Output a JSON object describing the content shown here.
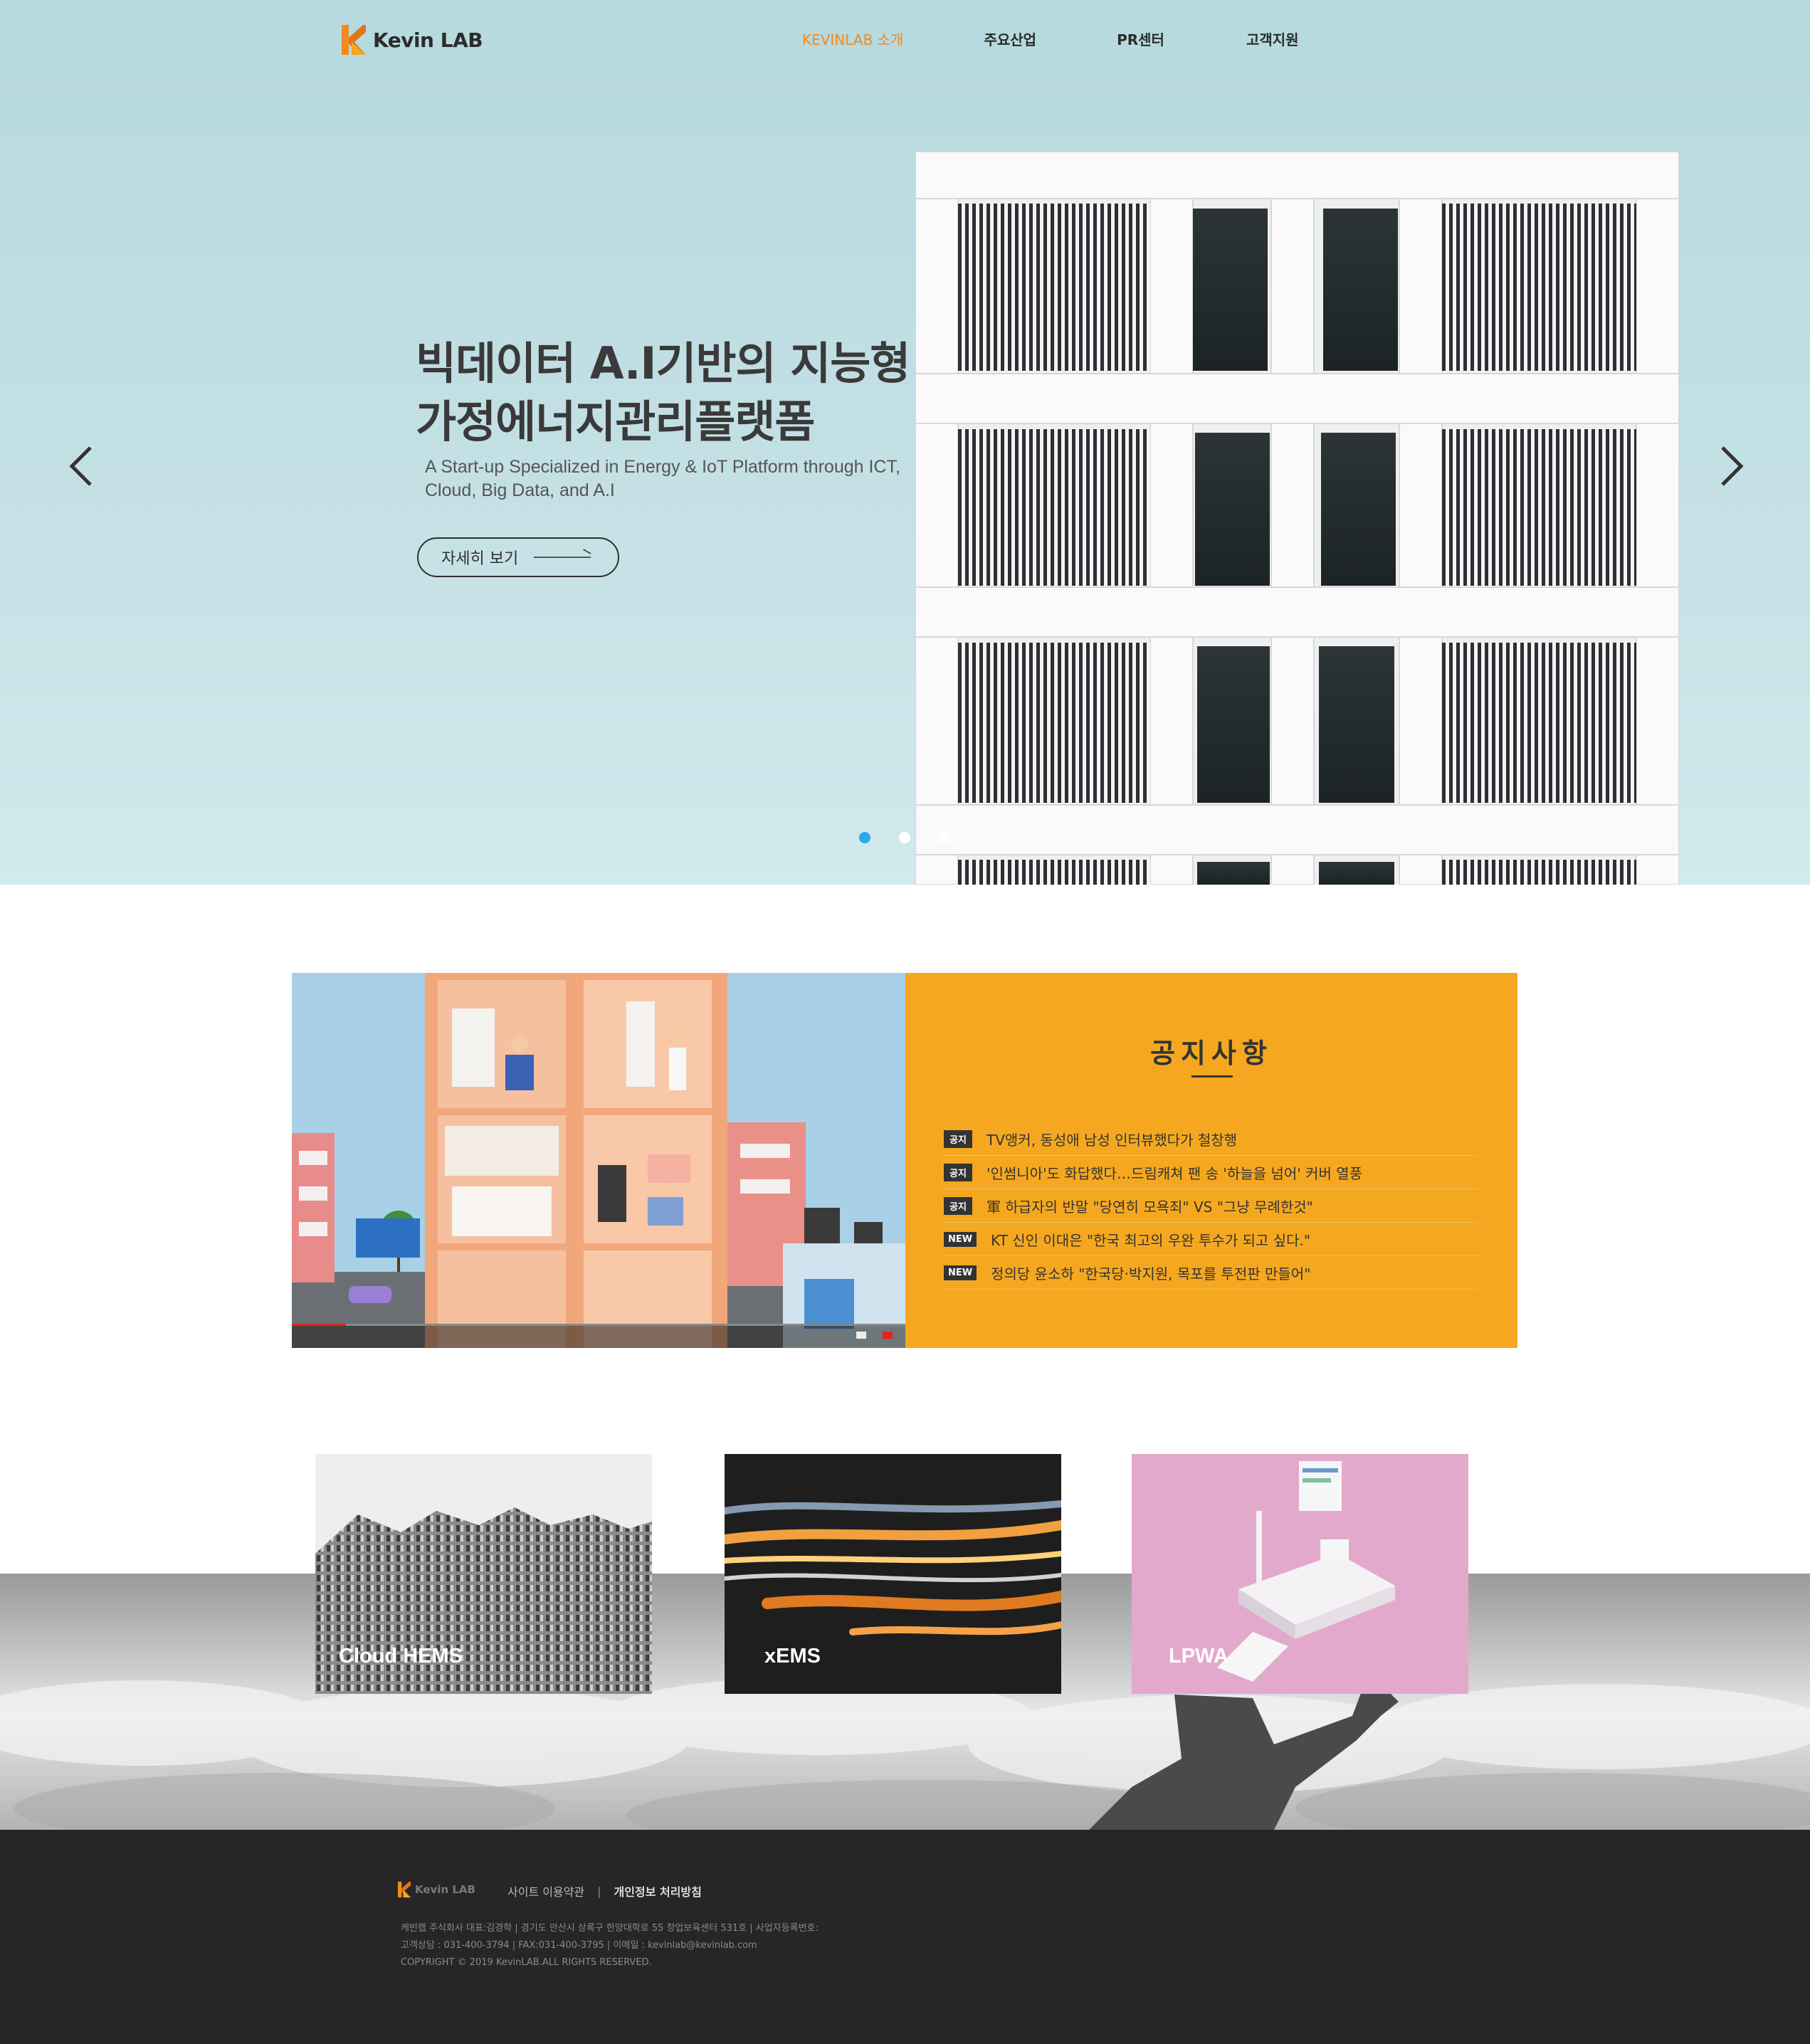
{
  "header": {
    "logo_text": "Kevin LAB",
    "nav": [
      {
        "label": "KEVINLAB 소개",
        "active": true
      },
      {
        "label": "주요산업",
        "active": false
      },
      {
        "label": "PR센터",
        "active": false
      },
      {
        "label": "고객지원",
        "active": false
      }
    ]
  },
  "hero": {
    "title_line1": "빅데이터 A.I기반의 지능형",
    "title_line2": "가정에너지관리플랫폼",
    "subtitle_line1": "A Start-up Specialized in Energy & IoT Platform through ICT,",
    "subtitle_line2": "Cloud, Big Data, and A.I",
    "button_label": "자세히 보기",
    "prev_icon": "chevron-left-icon",
    "next_icon": "chevron-right-icon",
    "slides_total": 3,
    "slide_active": 1
  },
  "notice": {
    "title": "공지사항",
    "items": [
      {
        "badge": "공지",
        "text": "TV앵커, 동성애 남성 인터뷰했다가 철창행"
      },
      {
        "badge": "공지",
        "text": "'인썸니아'도 화답했다…드림캐쳐 팬 송 '하늘을 넘어' 커버 열풍"
      },
      {
        "badge": "공지",
        "text": "軍 하급자의 반말 \"당연히 모욕죄\" VS \"그냥 무례한것\""
      },
      {
        "badge": "NEW",
        "text": "KT 신인 이대은 \"한국 최고의 우완 투수가 되고 싶다.\""
      },
      {
        "badge": "NEW",
        "text": "정의당 윤소하 \"한국당·박지원, 목포를 투전판 만들어\""
      }
    ]
  },
  "services": [
    {
      "label": "Cloud HEMS"
    },
    {
      "label": "xEMS"
    },
    {
      "label": "LPWA"
    }
  ],
  "footer": {
    "logo_text": "Kevin LAB",
    "links": [
      "사이트 이용약관",
      "개인정보 처리방침"
    ],
    "info_line1": "케빈랩 주식회사 대표:김경학   |   경기도 안산시 상록구 한양대학로 55 창업보육센터 531호   |   사업자등록번호:",
    "info_line2": "고객상담 : 031-400-3794   |   FAX:031-400-3795   |   이메일 : kevinlab@kevinlab.com",
    "info_line3": "COPYRIGHT © 2019 KevinLAB.ALL RIGHTS RESERVED."
  },
  "colors": {
    "accent": "#f28a1e",
    "notice_bg": "#f5a81f",
    "dot_active": "#2aa8e8",
    "footer_bg": "#262626"
  }
}
